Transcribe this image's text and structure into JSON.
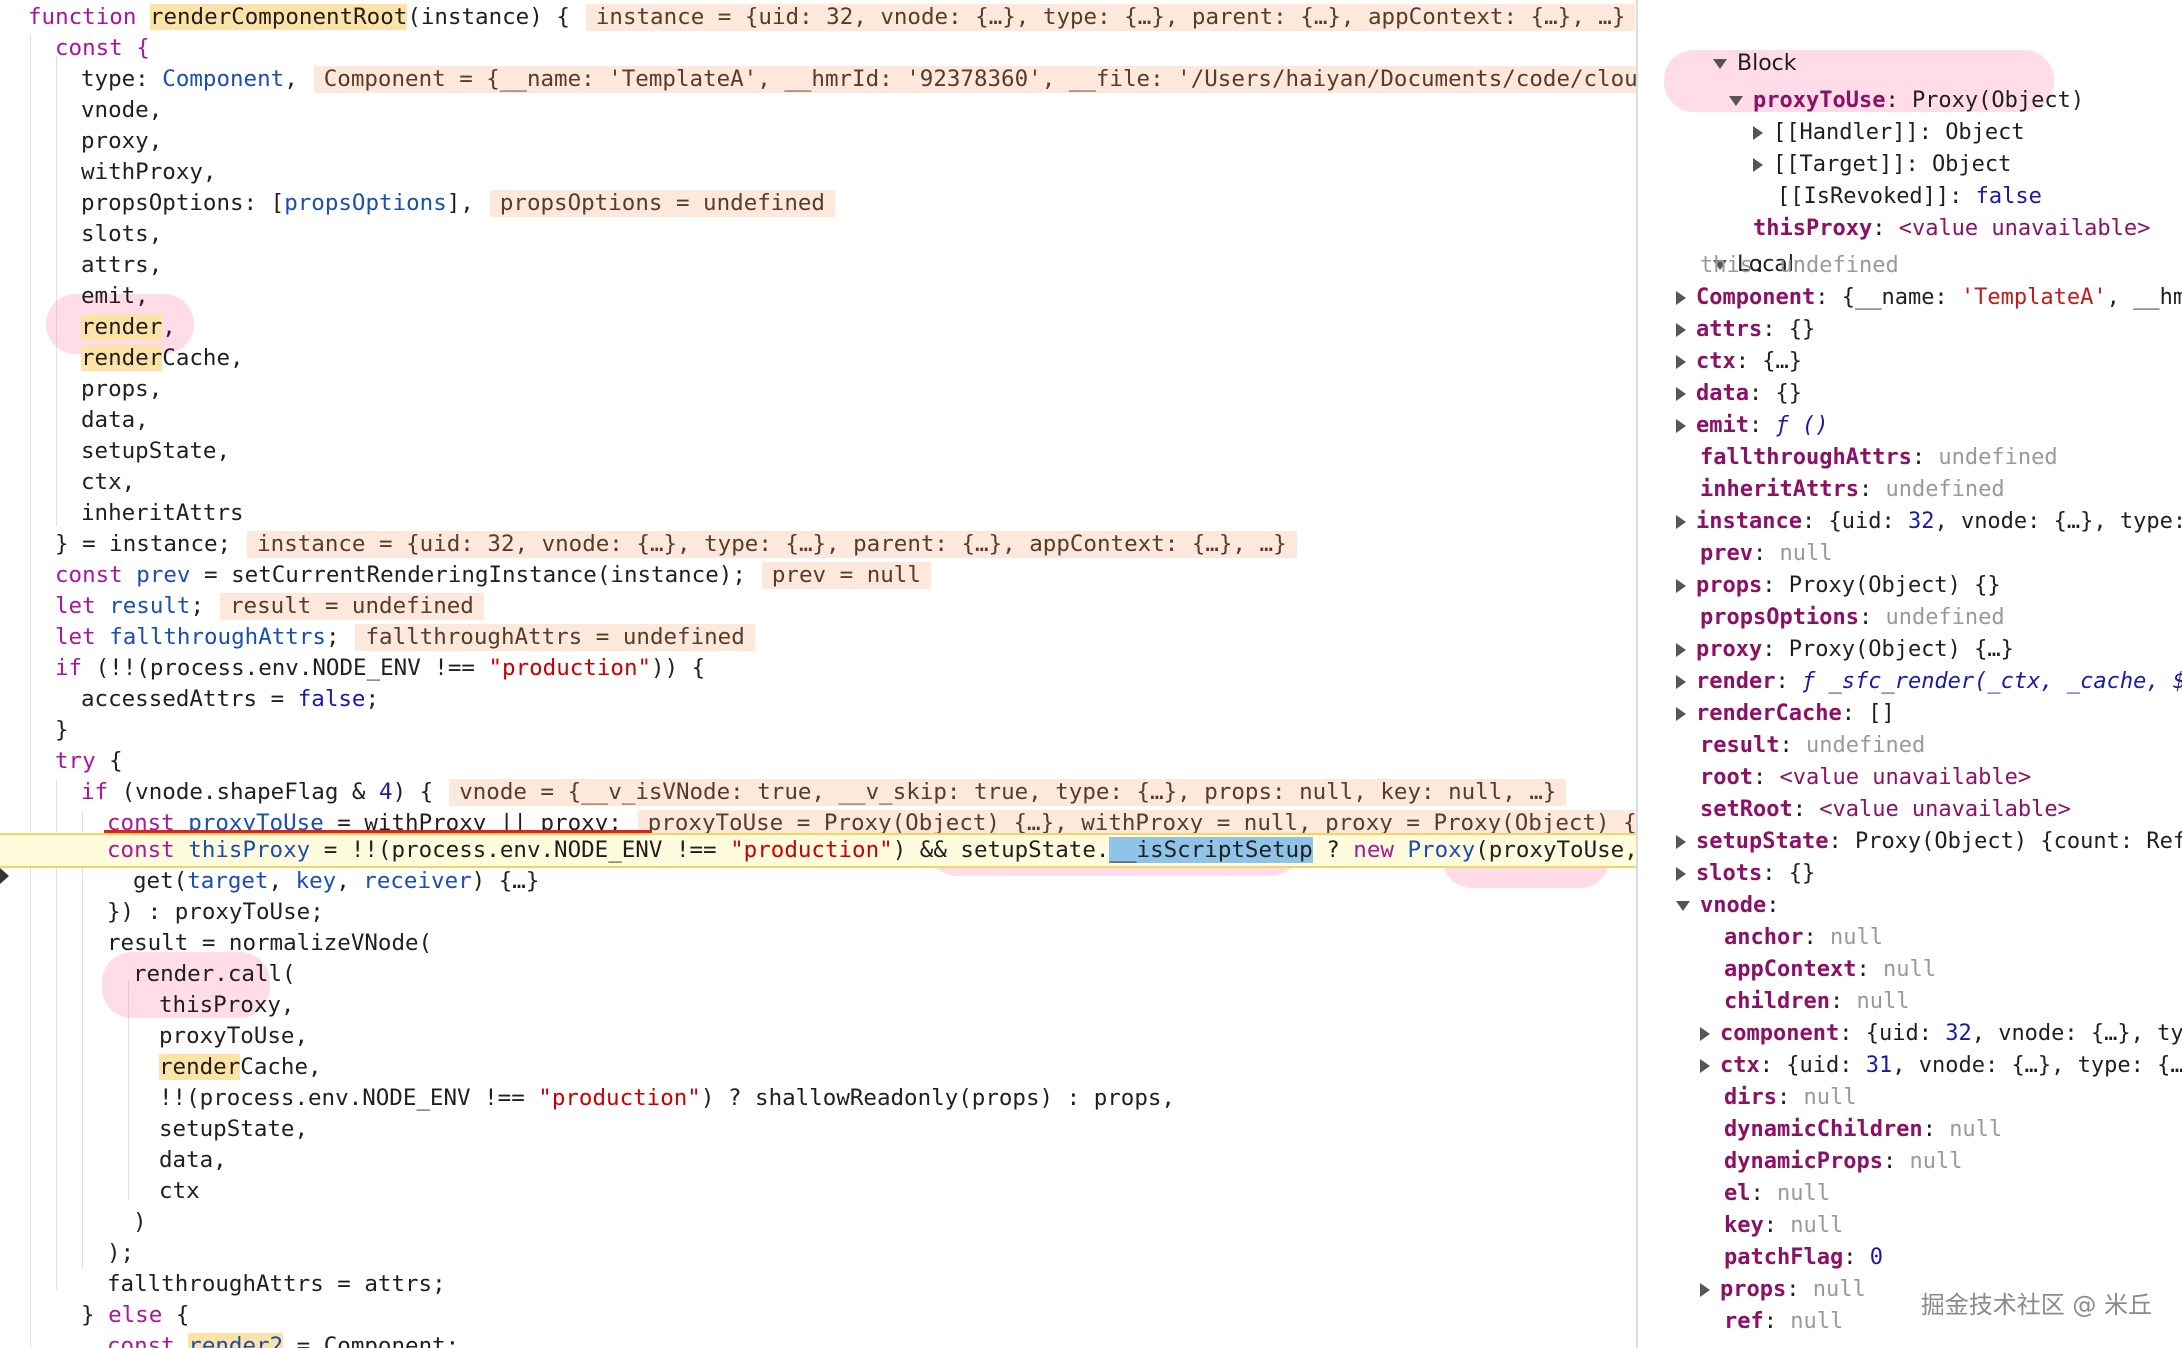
{
  "code": {
    "l1": {
      "kw": "function",
      "name": "renderComponentRoot",
      "args": "(instance) {",
      "ann": "instance = {uid: 32, vnode: {…}, type: {…}, parent: {…}, appContext: {…}, …}"
    },
    "l2": "const {",
    "l3": {
      "a": "type: ",
      "b": "Component",
      "c": ",",
      "ann": "Component = {__name: 'TemplateA', __hmrId: '92378360', __file: '/Users/haiyan/Documents/code/cloudc"
    },
    "l4": "vnode,",
    "l5": "proxy,",
    "l6": "withProxy,",
    "l7": {
      "a": "propsOptions: [",
      "b": "propsOptions",
      "c": "],",
      "ann": "propsOptions = undefined"
    },
    "l8": "slots,",
    "l9": "attrs,",
    "l10": "emit,",
    "l11": {
      "a": "render",
      "b": ","
    },
    "l12": {
      "a": "render",
      "b": "Cache,"
    },
    "l13": "props,",
    "l14": "data,",
    "l15": "setupState,",
    "l16": "ctx,",
    "l17": "inheritAttrs",
    "l18": {
      "a": "} = instance;",
      "ann": "instance = {uid: 32, vnode: {…}, type: {…}, parent: {…}, appContext: {…}, …}"
    },
    "l19": {
      "kw": "const ",
      "name": "prev",
      "rest": " = setCurrentRenderingInstance(instance);",
      "ann": "prev = null"
    },
    "l20": {
      "kw": "let ",
      "name": "result",
      "rest": ";",
      "ann": "result = undefined"
    },
    "l21": {
      "kw": "let ",
      "name": "fallthroughAttrs",
      "rest": ";",
      "ann": "fallthroughAttrs = undefined"
    },
    "l22": {
      "kw": "if ",
      "a": "(!!(process.env.NODE_ENV !== ",
      "str": "\"production\"",
      "b": ")) {"
    },
    "l23": {
      "a": "accessedAttrs = ",
      "kw": "false",
      "b": ";"
    },
    "l24": "}",
    "l25": {
      "kw": "try",
      "b": " {"
    },
    "l26": {
      "kw": "if ",
      "a": "(vnode.shapeFlag & ",
      "num": "4",
      "b": ") {",
      "ann": "vnode = {__v_isVNode: true, __v_skip: true, type: {…}, props: null, key: null, …}"
    },
    "l27": {
      "kw": "const ",
      "name": "proxyToUse",
      "rest": " = withProxy || proxy;",
      "ann": "proxyToUse = Proxy(Object) {…}, withProxy = null, proxy = Proxy(Object) {…}"
    },
    "l28": {
      "kw": "const ",
      "name": "thisProxy",
      "a": " = !!(process.env.NODE_ENV !== ",
      "str": "\"production\"",
      "b": ") && setupState.",
      "sel": "__isScriptSetup",
      "c": " ? ",
      "kw2": "new ",
      "ty": "Proxy",
      "d": "(proxyToUse, {"
    },
    "l29": {
      "a": "get(",
      "p1": "target",
      "c1": ", ",
      "p2": "key",
      "c2": ", ",
      "p3": "receiver",
      "b": ") {…}"
    },
    "l30": "}) : proxyToUse;",
    "l31": "result = normalizeVNode(",
    "l32": "render.call(",
    "l33": "thisProxy,",
    "l34": "proxyToUse,",
    "l35": {
      "a": "render",
      "b": "Cache,"
    },
    "l36": {
      "a": "!!(process.env.NODE_ENV !== ",
      "str": "\"production\"",
      "b": ") ? shallowReadonly(props) : props,"
    },
    "l37": "setupState,",
    "l38": "data,",
    "l39": "ctx",
    "l40": ")",
    "l41": ");",
    "l42": "fallthroughAttrs = attrs;",
    "l43": {
      "a": "} ",
      "kw": "else",
      "b": " {"
    },
    "l44": {
      "kw": "const ",
      "name": "render2",
      "rest": " = Component;"
    }
  },
  "scope": {
    "block_header": "Block",
    "block": [
      {
        "key": "proxyToUse",
        "val": "Proxy(Object)",
        "expanded": true
      },
      {
        "key": "[[Handler]]",
        "val": "Object"
      },
      {
        "key": "[[Target]]",
        "val": "Object"
      },
      {
        "key": "[[IsRevoked]]",
        "val": "false"
      },
      {
        "key": "thisProxy",
        "val": "<value unavailable>"
      }
    ],
    "local_header": "Local",
    "local": [
      {
        "key": "this",
        "val": "undefined"
      },
      {
        "key": "Component",
        "val": "{__name: ",
        "str": "'TemplateA'",
        "tail": ", __hm"
      },
      {
        "key": "attrs",
        "val": "{}"
      },
      {
        "key": "ctx",
        "val": "{…}"
      },
      {
        "key": "data",
        "val": "{}"
      },
      {
        "key": "emit",
        "val": "ƒ ()"
      },
      {
        "key": "fallthroughAttrs",
        "val": "undefined"
      },
      {
        "key": "inheritAttrs",
        "val": "undefined"
      },
      {
        "key": "instance",
        "val": "{uid: ",
        "num": "32",
        "tail": ", vnode: {…}, type:"
      },
      {
        "key": "prev",
        "val": "null"
      },
      {
        "key": "props",
        "val": "Proxy(Object) {}"
      },
      {
        "key": "propsOptions",
        "val": "undefined"
      },
      {
        "key": "proxy",
        "val": "Proxy(Object) {…}"
      },
      {
        "key": "render",
        "val": "ƒ _sfc_render(_ctx, _cache, $"
      },
      {
        "key": "renderCache",
        "val": "[]"
      },
      {
        "key": "result",
        "val": "undefined"
      },
      {
        "key": "root",
        "val": "<value unavailable>"
      },
      {
        "key": "setRoot",
        "val": "<value unavailable>"
      },
      {
        "key": "setupState",
        "val": "Proxy(Object) {count: Ref"
      },
      {
        "key": "slots",
        "val": "{}"
      },
      {
        "key": "vnode",
        "val": ""
      }
    ],
    "vnode": [
      {
        "key": "anchor",
        "val": "null"
      },
      {
        "key": "appContext",
        "val": "null"
      },
      {
        "key": "children",
        "val": "null"
      },
      {
        "key": "component",
        "val": "{uid: ",
        "num": "32",
        "tail": ", vnode: {…}, ty"
      },
      {
        "key": "ctx",
        "val": "{uid: ",
        "num": "31",
        "tail": ", vnode: {…}, type: {…"
      },
      {
        "key": "dirs",
        "val": "null"
      },
      {
        "key": "dynamicChildren",
        "val": "null"
      },
      {
        "key": "dynamicProps",
        "val": "null"
      },
      {
        "key": "el",
        "val": "null"
      },
      {
        "key": "key",
        "val": "null"
      },
      {
        "key": "patchFlag",
        "val": "0"
      },
      {
        "key": "props",
        "val": "null"
      },
      {
        "key": "ref",
        "val": "null"
      }
    ]
  },
  "watermark": "掘金技术社区 @ 米丘"
}
